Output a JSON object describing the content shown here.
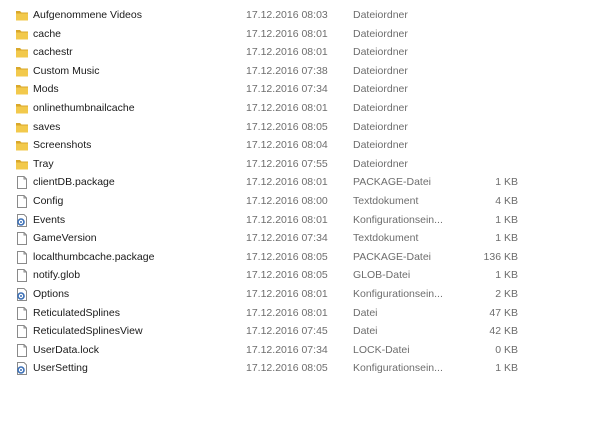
{
  "rows": [
    {
      "name": "Aufgenommene Videos",
      "date": "17.12.2016 08:03",
      "type": "Dateiordner",
      "size": "",
      "icon": "folder-icon"
    },
    {
      "name": "cache",
      "date": "17.12.2016 08:01",
      "type": "Dateiordner",
      "size": "",
      "icon": "folder-icon"
    },
    {
      "name": "cachestr",
      "date": "17.12.2016 08:01",
      "type": "Dateiordner",
      "size": "",
      "icon": "folder-icon"
    },
    {
      "name": "Custom Music",
      "date": "17.12.2016 07:38",
      "type": "Dateiordner",
      "size": "",
      "icon": "folder-icon"
    },
    {
      "name": "Mods",
      "date": "17.12.2016 07:34",
      "type": "Dateiordner",
      "size": "",
      "icon": "folder-icon"
    },
    {
      "name": "onlinethumbnailcache",
      "date": "17.12.2016 08:01",
      "type": "Dateiordner",
      "size": "",
      "icon": "folder-icon"
    },
    {
      "name": "saves",
      "date": "17.12.2016 08:05",
      "type": "Dateiordner",
      "size": "",
      "icon": "folder-icon"
    },
    {
      "name": "Screenshots",
      "date": "17.12.2016 08:04",
      "type": "Dateiordner",
      "size": "",
      "icon": "folder-icon"
    },
    {
      "name": "Tray",
      "date": "17.12.2016 07:55",
      "type": "Dateiordner",
      "size": "",
      "icon": "folder-icon"
    },
    {
      "name": "clientDB.package",
      "date": "17.12.2016 08:01",
      "type": "PACKAGE-Datei",
      "size": "1 KB",
      "icon": "file-icon"
    },
    {
      "name": "Config",
      "date": "17.12.2016 08:00",
      "type": "Textdokument",
      "size": "4 KB",
      "icon": "file-icon"
    },
    {
      "name": "Events",
      "date": "17.12.2016 08:01",
      "type": "Konfigurationsein...",
      "size": "1 KB",
      "icon": "settings-file-icon"
    },
    {
      "name": "GameVersion",
      "date": "17.12.2016 07:34",
      "type": "Textdokument",
      "size": "1 KB",
      "icon": "file-icon"
    },
    {
      "name": "localthumbcache.package",
      "date": "17.12.2016 08:05",
      "type": "PACKAGE-Datei",
      "size": "136 KB",
      "icon": "file-icon"
    },
    {
      "name": "notify.glob",
      "date": "17.12.2016 08:05",
      "type": "GLOB-Datei",
      "size": "1 KB",
      "icon": "file-icon"
    },
    {
      "name": "Options",
      "date": "17.12.2016 08:01",
      "type": "Konfigurationsein...",
      "size": "2 KB",
      "icon": "settings-file-icon"
    },
    {
      "name": "ReticulatedSplines",
      "date": "17.12.2016 08:01",
      "type": "Datei",
      "size": "47 KB",
      "icon": "file-icon"
    },
    {
      "name": "ReticulatedSplinesView",
      "date": "17.12.2016 07:45",
      "type": "Datei",
      "size": "42 KB",
      "icon": "file-icon"
    },
    {
      "name": "UserData.lock",
      "date": "17.12.2016 07:34",
      "type": "LOCK-Datei",
      "size": "0 KB",
      "icon": "file-icon"
    },
    {
      "name": "UserSetting",
      "date": "17.12.2016 08:05",
      "type": "Konfigurationsein...",
      "size": "1 KB",
      "icon": "settings-file-icon"
    }
  ],
  "colors": {
    "folder_front": "#f2c94c",
    "folder_back": "#d9a82b",
    "file_border": "#8a8a8a",
    "settings_gear": "#3b6fb6"
  }
}
